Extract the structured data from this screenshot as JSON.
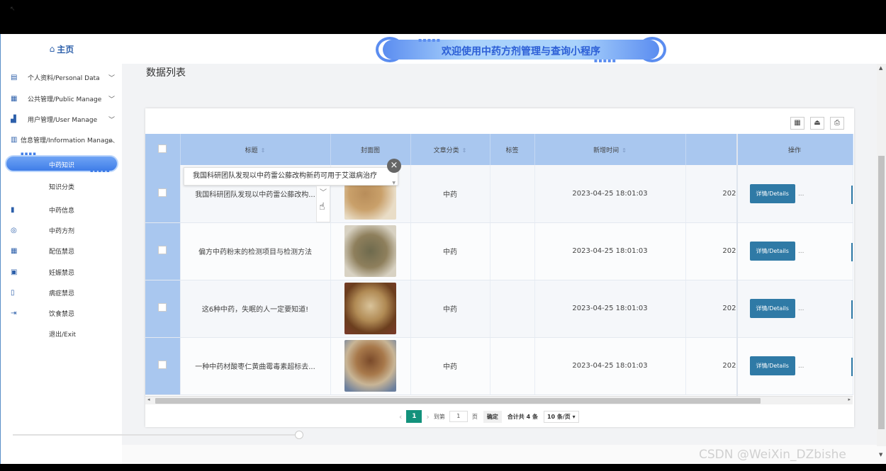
{
  "header": {
    "banner_title": "欢迎使用中药方剂管理与查询小程序"
  },
  "sidebar": {
    "home_label": "主页",
    "groups": [
      {
        "label": "个人资料/Personal Data"
      },
      {
        "label": "公共管理/Public Manage"
      },
      {
        "label": "用户管理/User Manage"
      },
      {
        "label": "信息管理/Information Manage"
      }
    ],
    "sub_items": [
      {
        "label": "中药知识"
      },
      {
        "label": "知识分类"
      },
      {
        "label": "中药信息"
      },
      {
        "label": "中药方剂"
      },
      {
        "label": "配伍禁忌"
      },
      {
        "label": "妊娠禁忌"
      },
      {
        "label": "病症禁忌"
      },
      {
        "label": "饮食禁忌"
      },
      {
        "label": "退出/Exit"
      }
    ]
  },
  "main": {
    "page_title": "数据列表",
    "columns": {
      "title": "标题",
      "cover": "封面图",
      "category": "文章分类",
      "tags": "标签",
      "added_time": "新增时间",
      "ops": "操作"
    },
    "rows": [
      {
        "title": "我国科研团队发现以中药雷公藤改构...",
        "category": "中药",
        "added_time": "2023-04-25 18:01:03",
        "clip": "202",
        "details": "详情/Details",
        "more": "..."
      },
      {
        "title": "偏方中药粉末的检测项目与检测方法",
        "category": "中药",
        "added_time": "2023-04-25 18:01:03",
        "clip": "202",
        "details": "详情/Details",
        "more": "..."
      },
      {
        "title": "这6种中药，失眠的人一定要知道!",
        "category": "中药",
        "added_time": "2023-04-25 18:01:03",
        "clip": "202",
        "details": "详情/Details",
        "more": "..."
      },
      {
        "title": "一种中药材酸枣仁黄曲霉毒素超标去...",
        "category": "中药",
        "added_time": "2023-04-25 18:01:03",
        "clip": "202",
        "details": "详情/Details",
        "more": "..."
      }
    ],
    "tooltip_text": "我国科研团队发现以中药雷公藤改构新药可用于艾滋病治疗",
    "pagination": {
      "current_page": "1",
      "goto_label": "到第",
      "goto_value": "1",
      "page_unit": "页",
      "confirm": "确定",
      "total": "合计共 4 条",
      "page_size": "10 条/页"
    }
  },
  "watermark": "CSDN @WeiXin_DZbishe"
}
